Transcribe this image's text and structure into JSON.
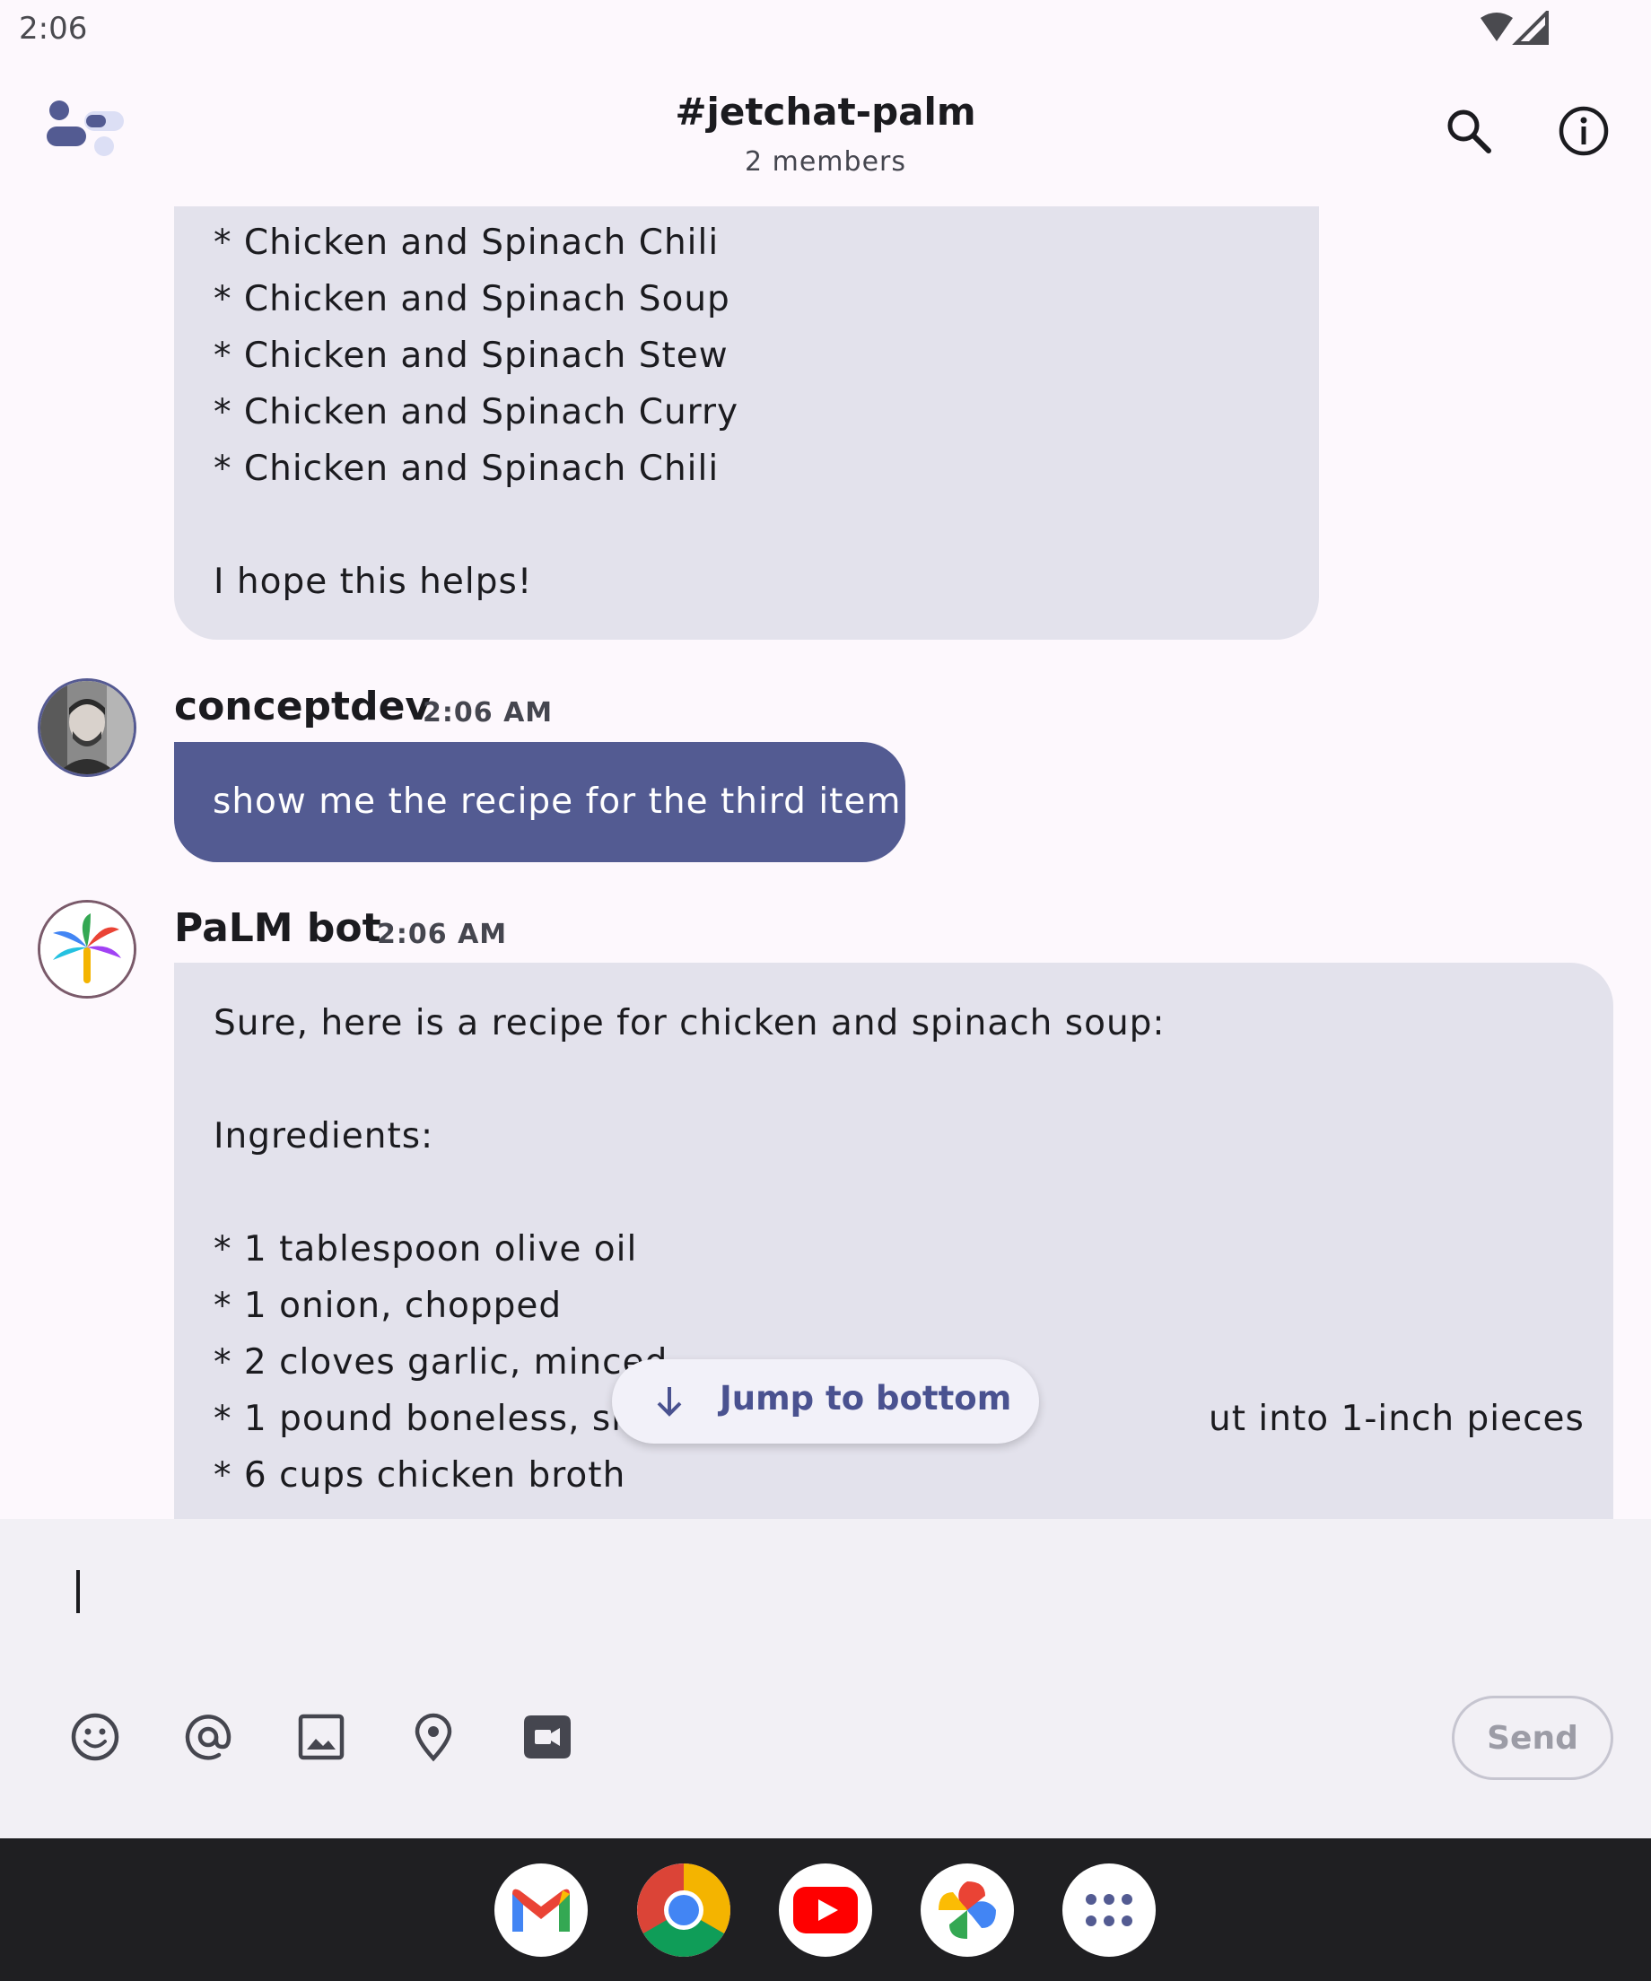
{
  "status_bar": {
    "time": "2:06"
  },
  "header": {
    "title": "#jetchat-palm",
    "subtitle": "2 members"
  },
  "messages": {
    "previous_bot_message": {
      "lines": [
        "* Chicken and Spinach Chili",
        "* Chicken and Spinach Soup",
        "* Chicken and Spinach Stew",
        "* Chicken and Spinach Curry",
        "* Chicken and Spinach Chili",
        "",
        "I hope this helps!"
      ]
    },
    "user_message": {
      "author": "conceptdev",
      "time": "2:06 AM",
      "text": "show me the recipe for the third item"
    },
    "bot_message": {
      "author": "PaLM bot",
      "time": "2:06 AM",
      "lines": [
        "Sure, here is a recipe for chicken and spinach soup:",
        "",
        "Ingredients:",
        "",
        "* 1 tablespoon olive oil",
        "* 1 onion, chopped",
        "* 2 cloves garlic, minced",
        "* 1 pound boneless, ski",
        "* 6 cups chicken broth"
      ],
      "partial_line_right": "ut into 1-inch pieces"
    }
  },
  "jump_button": {
    "label": "Jump to bottom"
  },
  "composer": {
    "input_value": "",
    "send_label": "Send",
    "tools": [
      "emoji-icon",
      "mention-icon",
      "image-icon",
      "location-icon",
      "video-icon"
    ]
  },
  "taskbar": {
    "apps": [
      "gmail-icon",
      "chrome-icon",
      "youtube-icon",
      "photos-icon",
      "app-drawer-icon"
    ]
  },
  "colors": {
    "accent": "#535b92",
    "bubble_other": "#e3e2ec",
    "background": "#fdf8fd",
    "taskbar": "#1f1f22"
  }
}
